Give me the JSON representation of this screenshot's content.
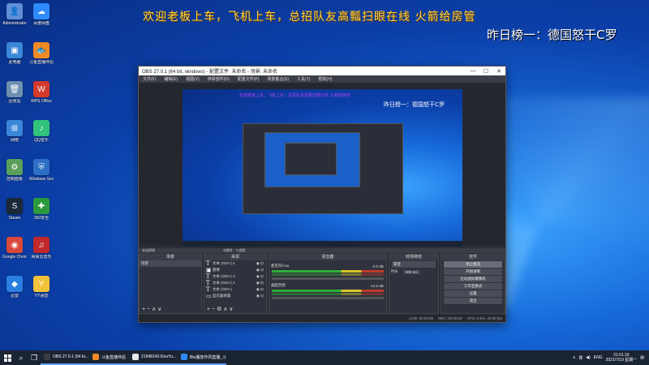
{
  "marquee": "欢迎老板上车，飞机上车，总招队友高瓢扫眼在线 火箭给房管",
  "rank_text": "昨日榜一：德国怒干C罗",
  "desktop_icons": [
    {
      "label": "Administrator",
      "color": "#5f8fd6",
      "glyph": "👤"
    },
    {
      "label": "此电脑",
      "color": "#3a87d8",
      "glyph": "▣"
    },
    {
      "label": "回收站",
      "color": "#6e8fb0",
      "glyph": "🗑"
    },
    {
      "label": "网络",
      "color": "#3a87d8",
      "glyph": "⊞"
    },
    {
      "label": "控制面板",
      "color": "#5aa05a",
      "glyph": "⚙"
    },
    {
      "label": "Steam",
      "color": "#1b2838",
      "glyph": "S"
    },
    {
      "label": "Google Chrome",
      "color": "#d9483b",
      "glyph": "◉"
    },
    {
      "label": "迅雷",
      "color": "#2a7fe0",
      "glyph": "◆"
    },
    {
      "label": "百度网盘",
      "color": "#2e8bff",
      "glyph": "☁"
    },
    {
      "label": "斗鱼直播伴侣",
      "color": "#f08a24",
      "glyph": "🐟"
    },
    {
      "label": "WPS Office",
      "color": "#d33a2c",
      "glyph": "W"
    },
    {
      "label": "QQ音乐",
      "color": "#31c27c",
      "glyph": "♪"
    },
    {
      "label": "Windows Security",
      "color": "#2d6fc4",
      "glyph": "⛨"
    },
    {
      "label": "360安全",
      "color": "#2c9a3c",
      "glyph": "✚"
    },
    {
      "label": "网易云音乐",
      "color": "#c2282c",
      "glyph": "♫"
    },
    {
      "label": "YY语音",
      "color": "#f2c23a",
      "glyph": "Y"
    }
  ],
  "obs": {
    "title": "OBS 27.0.1 (64 bit, windows) - 配置文件: 未命名 - 场景: 未命名",
    "menu": [
      "文件(F)",
      "编辑(E)",
      "视图(V)",
      "停靠部件(D)",
      "配置文件(P)",
      "场景集合(S)",
      "工具(T)",
      "帮助(H)"
    ],
    "preview_marquee": "欢迎老板上车，飞机上车，总招队友高瓢扫眼在线 火箭给房管",
    "preview_rank": "昨日榜一：德国怒干C罗",
    "dock_bar": "未选择源",
    "dock_bar_extra": [
      "⚙属性",
      "✎滤镜"
    ],
    "docks": {
      "scenes": {
        "title": "场景",
        "items": [
          "场景"
        ]
      },
      "sources": {
        "title": "来源",
        "items": [
          {
            "icon": "T",
            "name": "文本 (GDI+) 4"
          },
          {
            "icon": "▣",
            "name": "图像"
          },
          {
            "icon": "T",
            "name": "文本 (GDI+) 3"
          },
          {
            "icon": "T",
            "name": "文本 (GDI+) 2"
          },
          {
            "icon": "T",
            "name": "文本 (GDI+)"
          },
          {
            "icon": "▭",
            "name": "显示器采集"
          }
        ]
      },
      "mixer": {
        "title": "混音器",
        "channels": [
          {
            "name": "麦克风/Aux",
            "db": "-0.0 dB"
          },
          {
            "name": "桌面音频",
            "db": "-12.6 dB"
          }
        ]
      },
      "transitions": {
        "title": "转场特效",
        "type": "渐变",
        "duration_label": "时长",
        "duration": "300 ms"
      },
      "controls": {
        "title": "控件",
        "buttons": [
          "停止推流",
          "开始录制",
          "启动虚拟摄像机",
          "工作室模式",
          "设置",
          "退出"
        ]
      }
    },
    "status": [
      "LIVE: 00:00:00",
      "REC: 00:00:00",
      "CPU: 0.9%, 40.00 fps"
    ]
  },
  "taskbar": {
    "apps": [
      {
        "label": "OBS 27.0.1 (64 bi...",
        "color": "#3a3d47"
      },
      {
        "label": "斗鱼直播伴侣",
        "color": "#f08a24"
      },
      {
        "label": "21948142-DouYu...",
        "color": "#e8e8e8"
      },
      {
        "label": "Blu播放作风直播_斗...",
        "color": "#2e8bff"
      }
    ],
    "tray_lang": "ENG",
    "time": "21:51:16",
    "date": "2021/7/19 星期一"
  }
}
